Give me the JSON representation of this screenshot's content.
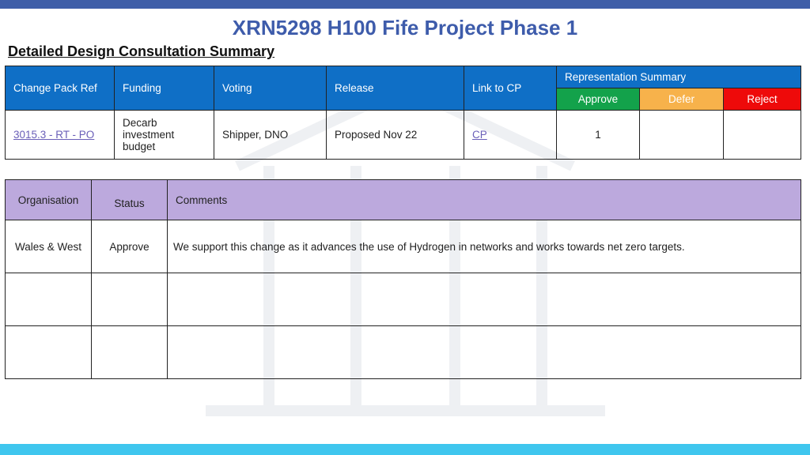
{
  "title": "XRN5298 H100 Fife Project Phase 1",
  "subtitle": "Detailed Design Consultation Summary",
  "summary_table": {
    "headers": {
      "change_pack_ref": "Change Pack Ref",
      "funding": "Funding",
      "voting": "Voting",
      "release": "Release",
      "link_to_cp": "Link to CP",
      "representation_summary": "Representation Summary",
      "approve": "Approve",
      "defer": "Defer",
      "reject": "Reject"
    },
    "row": {
      "change_pack_ref": "3015.3 - RT - PO",
      "funding": "Decarb investment budget",
      "voting": "Shipper, DNO",
      "release": "Proposed Nov 22",
      "link_to_cp": "CP",
      "approve": "1",
      "defer": "",
      "reject": ""
    }
  },
  "comments_table": {
    "headers": {
      "organisation": "Organisation",
      "status": "Status",
      "comments": "Comments"
    },
    "rows": [
      {
        "organisation": "Wales & West",
        "status": "Approve",
        "comments": "We support this change as it advances the use of Hydrogen in networks and works towards net zero targets."
      },
      {
        "organisation": "",
        "status": "",
        "comments": ""
      },
      {
        "organisation": "",
        "status": "",
        "comments": ""
      }
    ]
  },
  "colors": {
    "top_bar": "#3f5ea8",
    "bottom_bar": "#3fc6ee",
    "title": "#3e5cab",
    "header_blue": "#0f6fc6",
    "approve": "#13a24b",
    "defer": "#f7b24b",
    "reject": "#ee0a0a",
    "comments_header": "#bca9dd"
  }
}
